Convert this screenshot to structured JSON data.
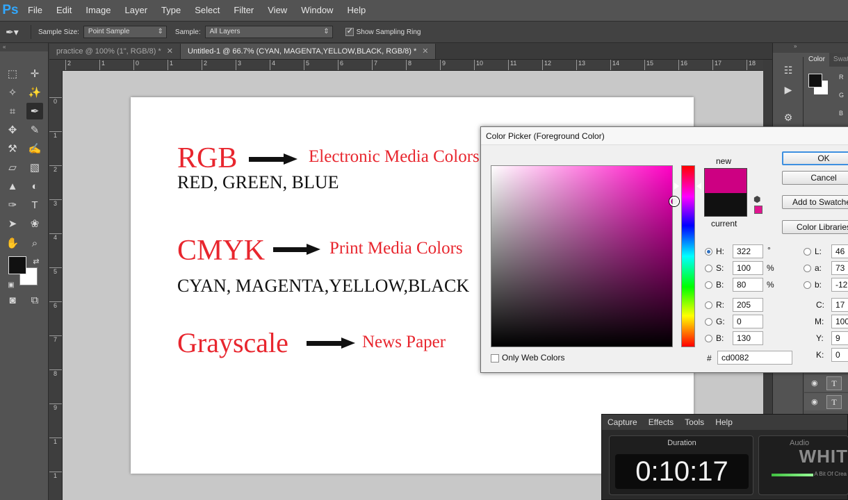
{
  "app": {
    "logo": "Ps"
  },
  "menubar": {
    "items": [
      "File",
      "Edit",
      "Image",
      "Layer",
      "Type",
      "Select",
      "Filter",
      "View",
      "Window",
      "Help"
    ]
  },
  "options_bar": {
    "tool_icon": "eyedropper-icon",
    "sample_size_label": "Sample Size:",
    "sample_size_value": "Point Sample",
    "sample_label": "Sample:",
    "sample_value": "All Layers",
    "show_ring_label": "Show Sampling Ring",
    "show_ring_checked": true
  },
  "tabs": [
    {
      "label": "practice @ 100% (1\", RGB/8) *",
      "active": false
    },
    {
      "label": "Untitled-1 @ 66.7% (CYAN, MAGENTA,YELLOW,BLACK, RGB/8) *",
      "active": true
    }
  ],
  "ruler": {
    "h": [
      "2",
      "1",
      "0",
      "1",
      "2",
      "3",
      "4",
      "5",
      "6",
      "7",
      "8",
      "9",
      "10",
      "11",
      "12",
      "13",
      "14",
      "15",
      "16",
      "17",
      "18"
    ],
    "v": [
      "0",
      "1",
      "2",
      "3",
      "4",
      "5",
      "6",
      "7",
      "8",
      "9",
      "1",
      "1"
    ]
  },
  "document": {
    "rgb_heading": "RGB",
    "rgb_note": "Electronic Media Colors",
    "rgb_sub": "RED, GREEN, BLUE",
    "cmyk_heading": "CMYK",
    "cmyk_note": "Print Media Colors",
    "cmyk_sub": "CYAN, MAGENTA,YELLOW,BLACK",
    "gray_heading": "Grayscale",
    "gray_note": "News Paper"
  },
  "color_panel": {
    "tab_active": "Color",
    "tab_other": "Swatches",
    "channels": [
      "R",
      "G",
      "B"
    ]
  },
  "color_picker": {
    "title": "Color Picker (Foreground Color)",
    "new_label": "new",
    "current_label": "current",
    "new_color": "#cd0082",
    "current_color": "#111111",
    "buttons": {
      "ok": "OK",
      "cancel": "Cancel",
      "add_swatches": "Add to Swatches",
      "libraries": "Color Libraries"
    },
    "hsb": [
      {
        "label": "H:",
        "value": "322",
        "unit": "°",
        "selected": true
      },
      {
        "label": "S:",
        "value": "100",
        "unit": "%",
        "selected": false
      },
      {
        "label": "B:",
        "value": "80",
        "unit": "%",
        "selected": false
      }
    ],
    "rgb": [
      {
        "label": "R:",
        "value": "205",
        "selected": false
      },
      {
        "label": "G:",
        "value": "0",
        "selected": false
      },
      {
        "label": "B:",
        "value": "130",
        "selected": false
      }
    ],
    "lab": [
      {
        "label": "L:",
        "value": "46",
        "selected": false
      },
      {
        "label": "a:",
        "value": "73",
        "selected": false
      },
      {
        "label": "b:",
        "value": "-12",
        "selected": false
      }
    ],
    "cmyk": [
      {
        "label": "C:",
        "value": "17"
      },
      {
        "label": "M:",
        "value": "100"
      },
      {
        "label": "Y:",
        "value": "9"
      },
      {
        "label": "K:",
        "value": "0"
      }
    ],
    "web_only_label": "Only Web Colors",
    "web_only_checked": false,
    "hex_label": "#",
    "hex_value": "cd0082"
  },
  "recorder": {
    "menu": [
      "Capture",
      "Effects",
      "Tools",
      "Help"
    ],
    "duration_label": "Duration",
    "time": "0:10:17",
    "audio_label": "Audio"
  },
  "watermark": {
    "text": "WHIT",
    "sub": "A Bit Of Crea"
  }
}
